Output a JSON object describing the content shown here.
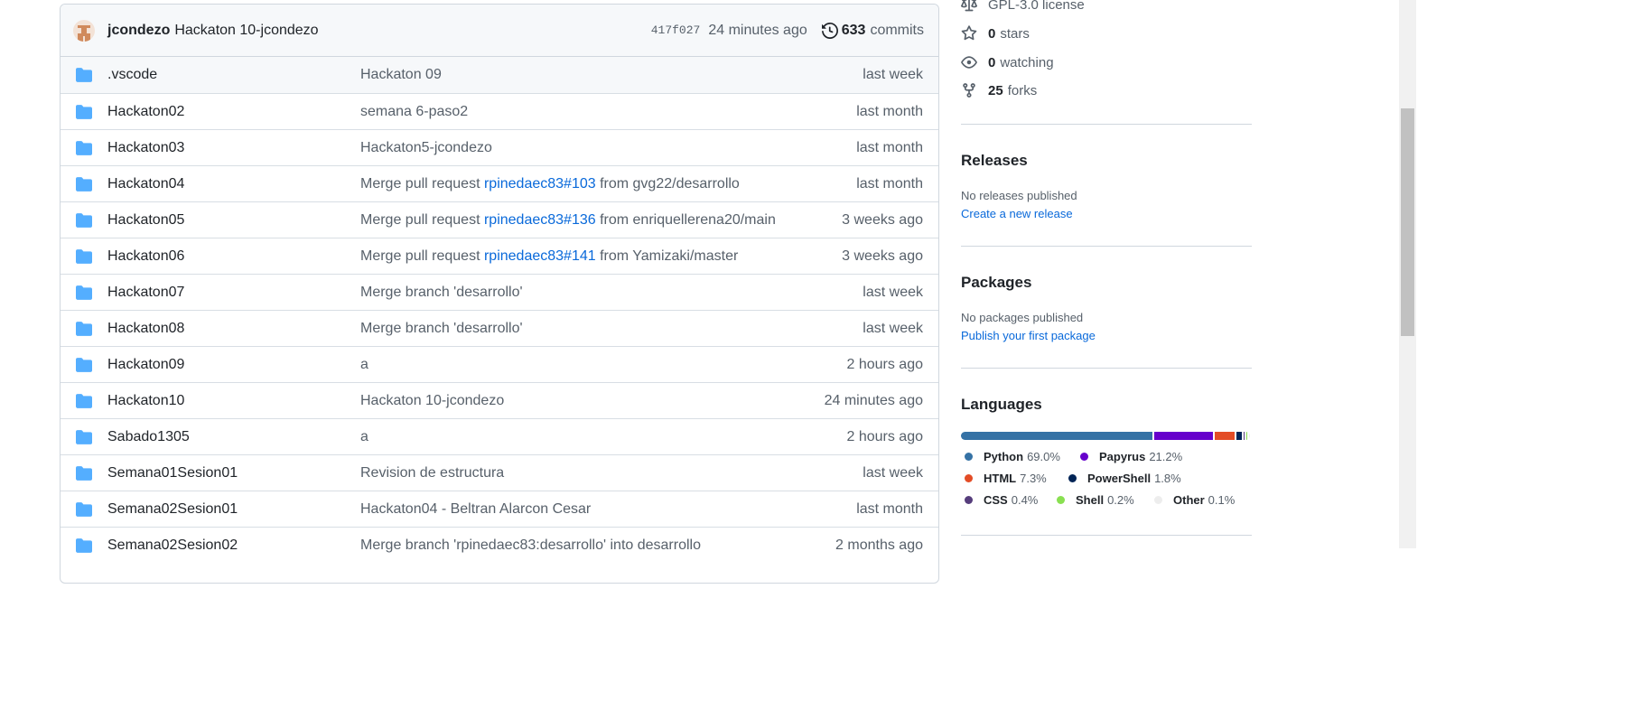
{
  "commit": {
    "author": "jcondezo",
    "message": "Hackaton 10-jcondezo",
    "sha": "417f027",
    "time": "24 minutes ago",
    "count": "633",
    "count_label": "commits"
  },
  "files": [
    {
      "name": ".vscode",
      "msg_pre": "Hackaton 09",
      "link": "",
      "msg_post": "",
      "age": "last week"
    },
    {
      "name": "Hackaton02",
      "msg_pre": "semana 6-paso2",
      "link": "",
      "msg_post": "",
      "age": "last month"
    },
    {
      "name": "Hackaton03",
      "msg_pre": "Hackaton5-jcondezo",
      "link": "",
      "msg_post": "",
      "age": "last month"
    },
    {
      "name": "Hackaton04",
      "msg_pre": "Merge pull request ",
      "link": "rpinedaec83#103",
      "msg_post": " from gvg22/desarrollo",
      "age": "last month"
    },
    {
      "name": "Hackaton05",
      "msg_pre": "Merge pull request ",
      "link": "rpinedaec83#136",
      "msg_post": " from enriquellerena20/main",
      "age": "3 weeks ago"
    },
    {
      "name": "Hackaton06",
      "msg_pre": "Merge pull request ",
      "link": "rpinedaec83#141",
      "msg_post": " from Yamizaki/master",
      "age": "3 weeks ago"
    },
    {
      "name": "Hackaton07",
      "msg_pre": "Merge branch 'desarrollo'",
      "link": "",
      "msg_post": "",
      "age": "last week"
    },
    {
      "name": "Hackaton08",
      "msg_pre": "Merge branch 'desarrollo'",
      "link": "",
      "msg_post": "",
      "age": "last week"
    },
    {
      "name": "Hackaton09",
      "msg_pre": "a",
      "link": "",
      "msg_post": "",
      "age": "2 hours ago"
    },
    {
      "name": "Hackaton10",
      "msg_pre": "Hackaton 10-jcondezo",
      "link": "",
      "msg_post": "",
      "age": "24 minutes ago"
    },
    {
      "name": "Sabado1305",
      "msg_pre": "a",
      "link": "",
      "msg_post": "",
      "age": "2 hours ago"
    },
    {
      "name": "Semana01Sesion01",
      "msg_pre": "Revision de estructura",
      "link": "",
      "msg_post": "",
      "age": "last week"
    },
    {
      "name": "Semana02Sesion01",
      "msg_pre": "Hackaton04 - Beltran Alarcon Cesar",
      "link": "",
      "msg_post": "",
      "age": "last month"
    },
    {
      "name": "Semana02Sesion02",
      "msg_pre": "Merge branch 'rpinedaec83:desarrollo' into desarrollo",
      "link": "",
      "msg_post": "",
      "age": "2 months ago"
    }
  ],
  "sidebar": {
    "license": "GPL-3.0 license",
    "stars_count": "0",
    "stars_label": "stars",
    "watching_count": "0",
    "watching_label": "watching",
    "forks_count": "25",
    "forks_label": "forks",
    "releases_title": "Releases",
    "releases_text": "No releases published",
    "releases_link": "Create a new release",
    "packages_title": "Packages",
    "packages_text": "No packages published",
    "packages_link": "Publish your first package",
    "languages_title": "Languages"
  },
  "languages": [
    {
      "name": "Python",
      "pct": "69.0%",
      "value": 69.0,
      "color": "#3572A5"
    },
    {
      "name": "Papyrus",
      "pct": "21.2%",
      "value": 21.2,
      "color": "#6600cc"
    },
    {
      "name": "HTML",
      "pct": "7.3%",
      "value": 7.3,
      "color": "#e34c26"
    },
    {
      "name": "PowerShell",
      "pct": "1.8%",
      "value": 1.8,
      "color": "#012456"
    },
    {
      "name": "CSS",
      "pct": "0.4%",
      "value": 0.4,
      "color": "#563d7c"
    },
    {
      "name": "Shell",
      "pct": "0.2%",
      "value": 0.2,
      "color": "#89e051"
    },
    {
      "name": "Other",
      "pct": "0.1%",
      "value": 0.1,
      "color": "#ededed"
    }
  ],
  "icons": {
    "folder": "folder-icon",
    "history": "history-icon",
    "license": "law-icon",
    "star": "star-icon",
    "eye": "eye-icon",
    "fork": "fork-icon"
  }
}
